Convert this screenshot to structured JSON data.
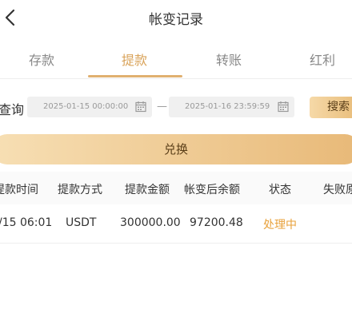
{
  "header": {
    "title": "帐变记录",
    "back_icon": "chevron-left-icon"
  },
  "tabs": [
    {
      "label": "存款",
      "active": false
    },
    {
      "label": "提款",
      "active": true
    },
    {
      "label": "转账",
      "active": false
    },
    {
      "label": "红利",
      "active": false
    }
  ],
  "filter": {
    "label": "查询",
    "start_date": "2025-01-15 00:00:00",
    "end_date": "2025-01-16 23:59:59",
    "separator": "—",
    "search_label": "搜索",
    "calendar_icon": "calendar-icon"
  },
  "exchange_label": "兑换",
  "table": {
    "headers": [
      "提款时间",
      "提款方式",
      "提款金额",
      "帐变后余额",
      "状态",
      "失败原"
    ],
    "rows": [
      {
        "time": "/15 06:01",
        "method": "USDT",
        "amount": "300000.00",
        "balance": "97200.48",
        "status": "处理中"
      }
    ]
  },
  "colors": {
    "accent": "#d9a35a",
    "status_pending": "#e8a13a"
  }
}
